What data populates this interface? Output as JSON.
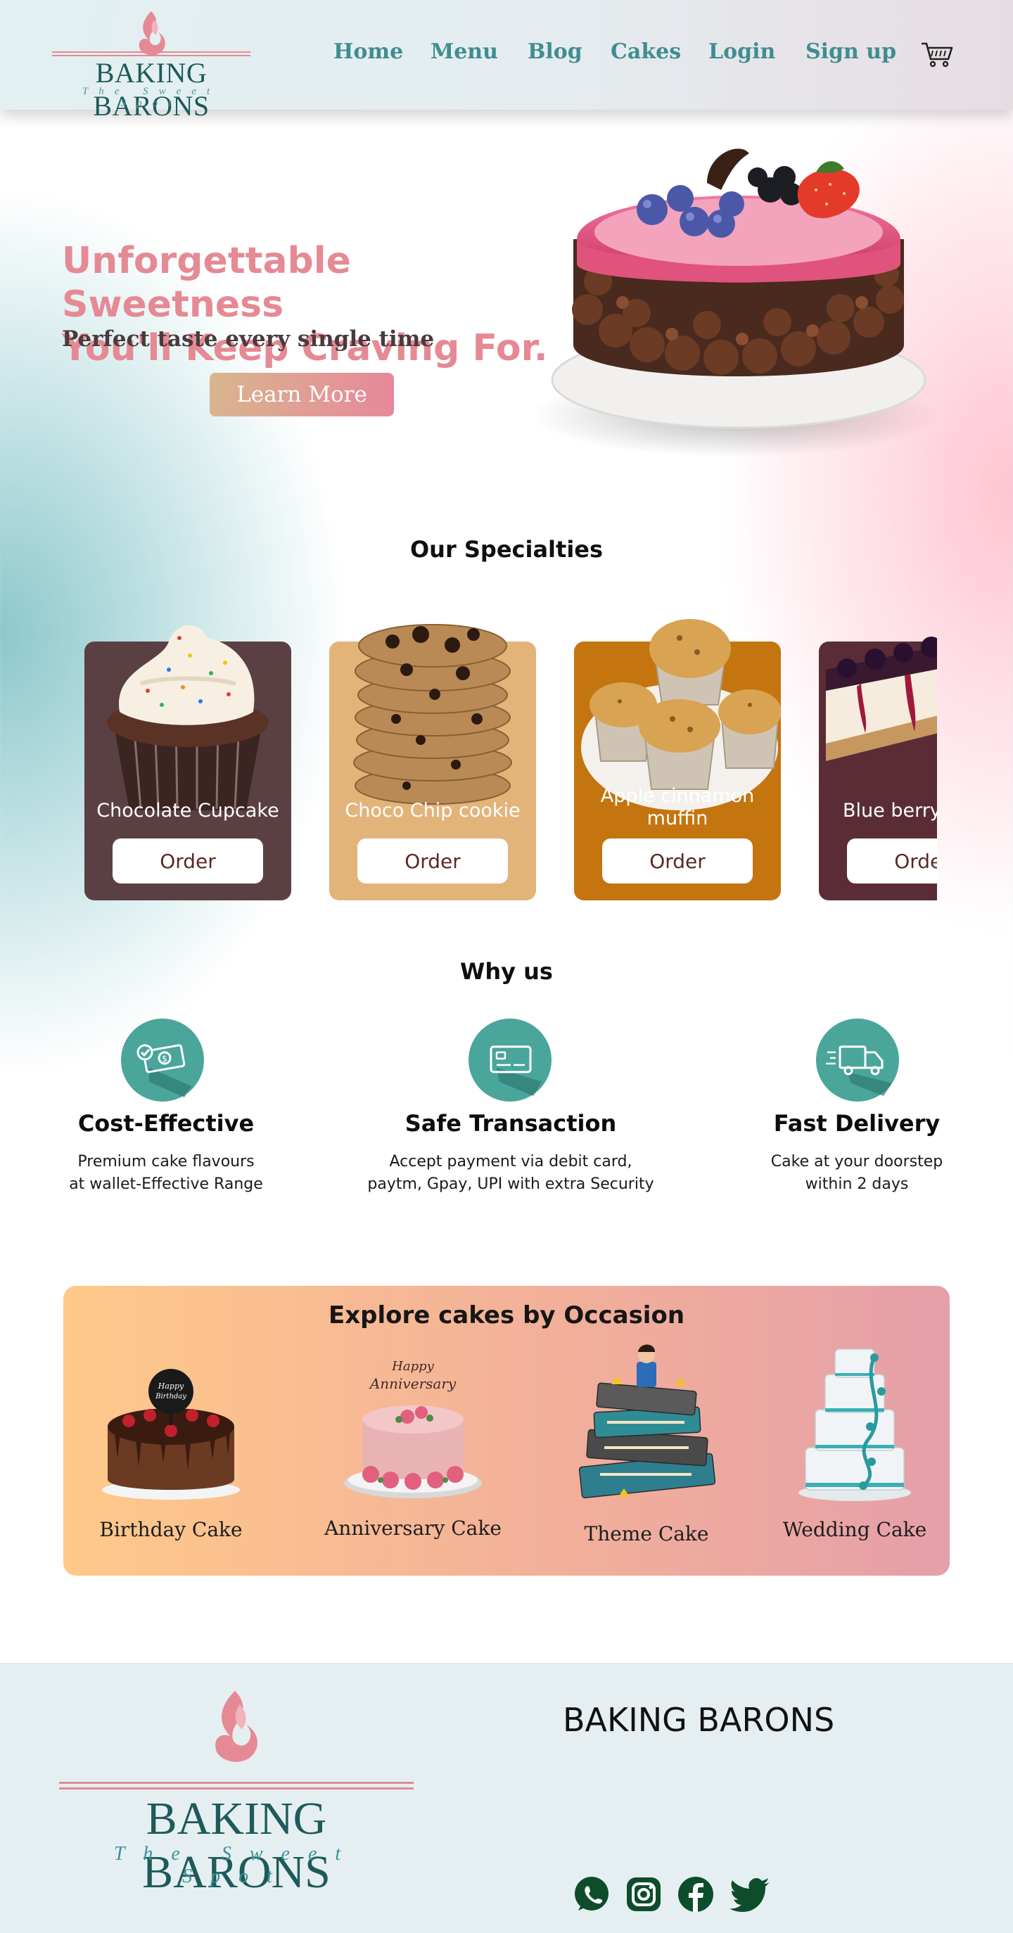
{
  "brand": {
    "name": "BAKING BARONS",
    "tagline": "The Sweet Spot"
  },
  "nav": {
    "items": [
      "Home",
      "Menu",
      "Blog",
      "Cakes",
      "Login",
      "Sign up"
    ],
    "cart_icon": "cart-icon"
  },
  "hero": {
    "title_line1": "Unforgettable Sweetness",
    "title_line2": "You'll Keep Craving For.",
    "subtitle": "Perfect taste every single time",
    "cta": "Learn More"
  },
  "specialties": {
    "title": "Our Specialties",
    "items": [
      {
        "name": "Chocolate Cupcake",
        "button": "Order",
        "color": "#5b4043"
      },
      {
        "name": "Choco Chip cookie",
        "button": "Order",
        "color": "#e3b47a"
      },
      {
        "name": "Apple cinnamon muffin",
        "button": "Order",
        "color": "#c4750f"
      },
      {
        "name": "Blue berry cheesecake",
        "button": "Order",
        "color": "#5a2d36"
      }
    ]
  },
  "why_us": {
    "title": "Why us",
    "items": [
      {
        "title": "Cost-Effective",
        "description": "Premium cake flavours\nat wallet-Effective Range",
        "icon": "cash-icon"
      },
      {
        "title": "Safe Transaction",
        "description": "Accept payment via debit card,\npaytm, Gpay, UPI with extra Security",
        "icon": "credit-card-icon"
      },
      {
        "title": "Fast Delivery",
        "description": "Cake at your doorstep\nwithin 2 days",
        "icon": "delivery-truck-icon"
      }
    ]
  },
  "occasions": {
    "title": "Explore cakes by Occasion",
    "items": [
      {
        "label": "Birthday Cake"
      },
      {
        "label": "Anniversary Cake"
      },
      {
        "label": "Theme Cake"
      },
      {
        "label": "Wedding Cake"
      }
    ]
  },
  "footer": {
    "brand": "BAKING BARONS",
    "social": [
      "whatsapp-icon",
      "instagram-icon",
      "facebook-icon",
      "twitter-icon"
    ]
  },
  "colors": {
    "teal": "#3f8d91",
    "pink": "#e58a94",
    "dark_teal": "#1f5a5a",
    "icon_circle": "#4aa59a",
    "social": "#0e4d2c"
  }
}
